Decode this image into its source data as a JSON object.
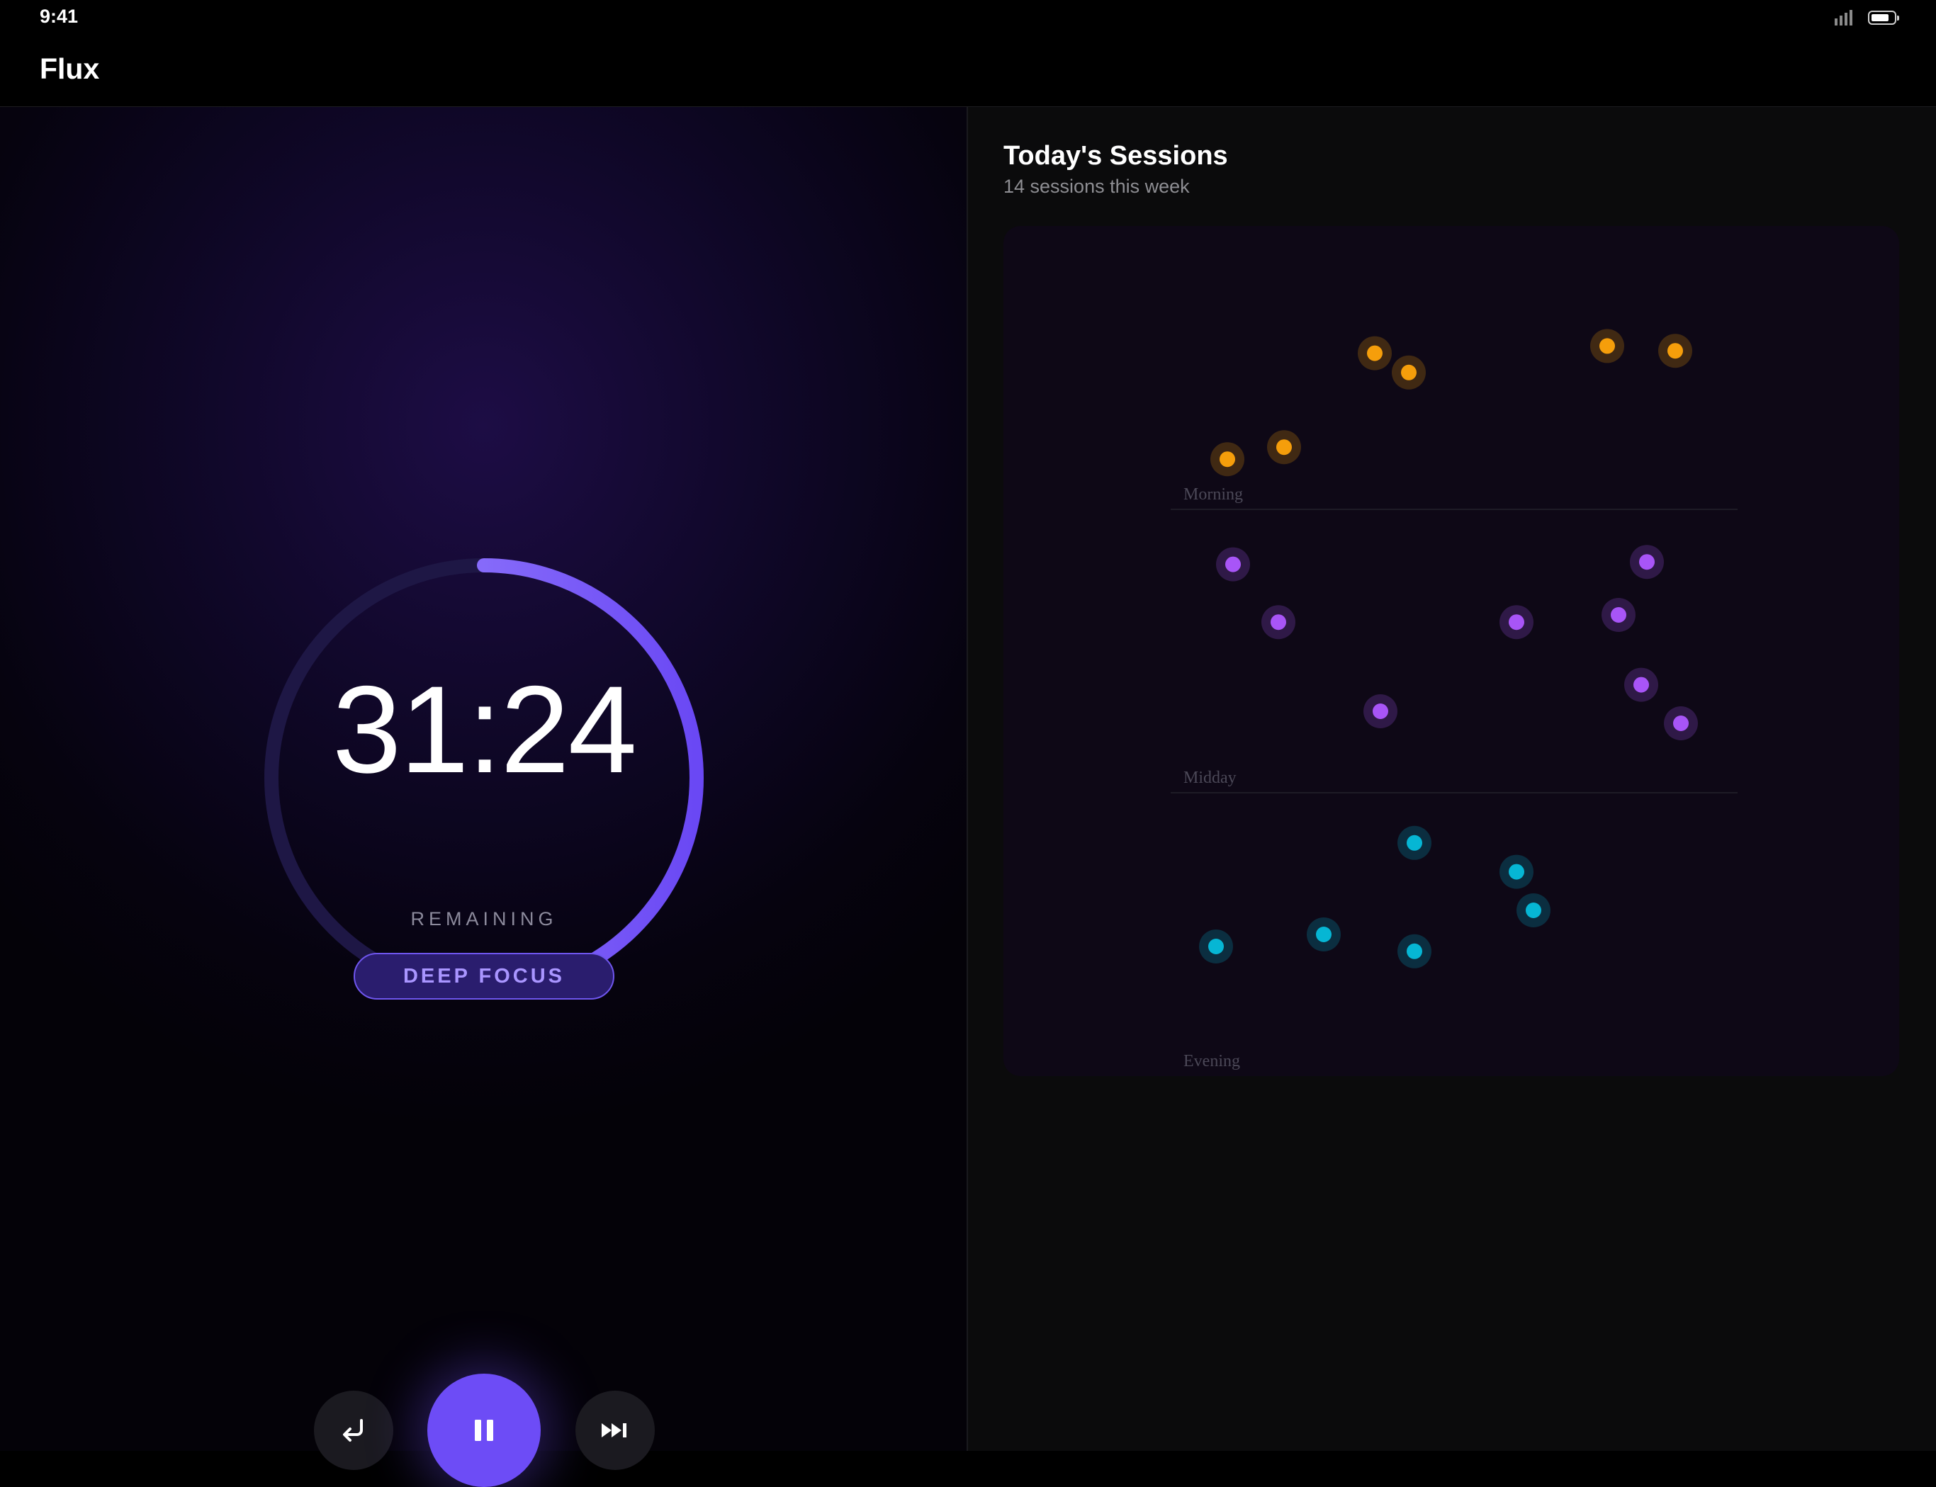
{
  "status_bar": {
    "time": "9:41",
    "icons": [
      "signal-icon",
      "battery-icon"
    ]
  },
  "app": {
    "title": "Flux"
  },
  "timer": {
    "time_remaining": "31:24",
    "remaining_label": "REMAINING",
    "mode": "DEEP FOCUS",
    "progress_fraction": 0.48,
    "colors": {
      "accent": "#6d4cf6",
      "ring_light": "#a18cff",
      "ring_track": "#1e1745"
    },
    "controls": {
      "reset_icon": "return-arrow-icon",
      "pause_icon": "pause-icon",
      "skip_icon": "skip-forward-icon"
    }
  },
  "sessions": {
    "title": "Today's Sessions",
    "subtitle": "14 sessions this week"
  },
  "chart_data": {
    "type": "scatter",
    "title": "",
    "xlabel": "",
    "ylabel": "",
    "y_bands": [
      "Morning",
      "Midday",
      "Evening"
    ],
    "x_range": [
      0,
      1
    ],
    "grid": "band separators",
    "legend": "none",
    "series": [
      {
        "band": "Morning",
        "color": "#f59e0b",
        "points": [
          {
            "x": 0.1,
            "y": 0.12
          },
          {
            "x": 0.2,
            "y": 0.17
          },
          {
            "x": 0.36,
            "y": 0.56
          },
          {
            "x": 0.42,
            "y": 0.48
          },
          {
            "x": 0.77,
            "y": 0.59
          },
          {
            "x": 0.89,
            "y": 0.57
          }
        ]
      },
      {
        "band": "Midday",
        "color": "#a855f7",
        "points": [
          {
            "x": 0.11,
            "y": 0.86
          },
          {
            "x": 0.19,
            "y": 0.62
          },
          {
            "x": 0.37,
            "y": 0.25
          },
          {
            "x": 0.61,
            "y": 0.62
          },
          {
            "x": 0.79,
            "y": 0.65
          },
          {
            "x": 0.84,
            "y": 0.87
          },
          {
            "x": 0.83,
            "y": 0.36
          },
          {
            "x": 0.9,
            "y": 0.2
          }
        ]
      },
      {
        "band": "Evening",
        "color": "#06b6d4",
        "points": [
          {
            "x": 0.08,
            "y": 0.45
          },
          {
            "x": 0.27,
            "y": 0.5
          },
          {
            "x": 0.43,
            "y": 0.88
          },
          {
            "x": 0.43,
            "y": 0.43
          },
          {
            "x": 0.61,
            "y": 0.76
          },
          {
            "x": 0.64,
            "y": 0.6
          }
        ]
      }
    ]
  }
}
